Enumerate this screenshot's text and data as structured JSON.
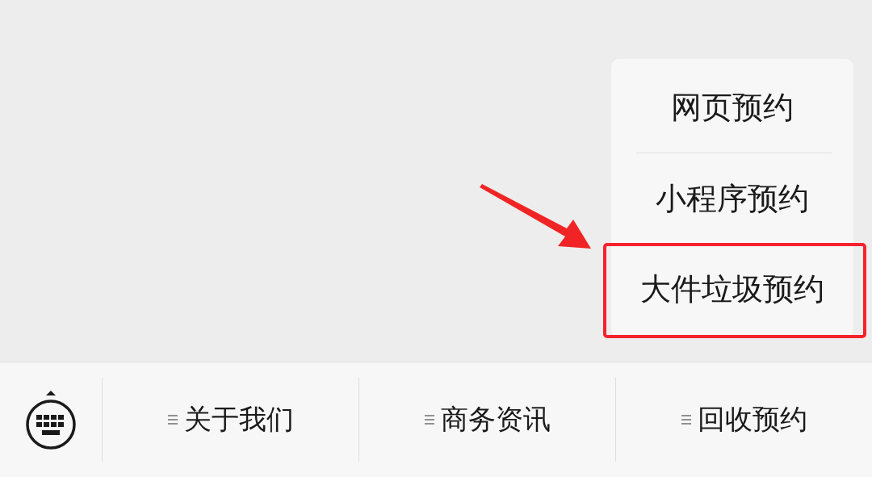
{
  "popup_menu": {
    "items": [
      {
        "label": "网页预约",
        "highlighted": false
      },
      {
        "label": "小程序预约",
        "highlighted": false
      },
      {
        "label": "大件垃圾预约",
        "highlighted": true
      }
    ]
  },
  "menu_bar": {
    "items": [
      {
        "label": "关于我们"
      },
      {
        "label": "商务资讯"
      },
      {
        "label": "回收预约"
      }
    ]
  }
}
